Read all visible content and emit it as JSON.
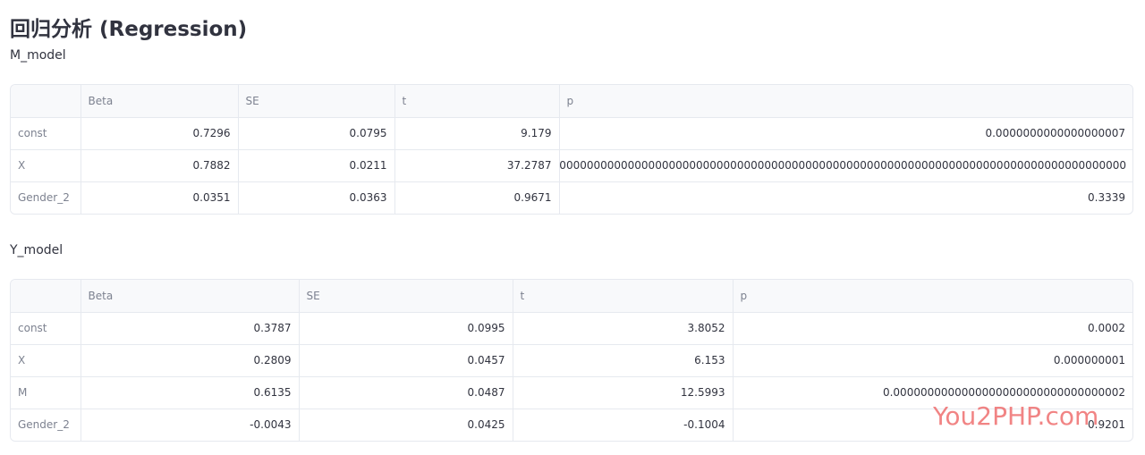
{
  "page": {
    "title": "回归分析 (Regression)"
  },
  "m_model": {
    "label": "M_model",
    "columns": [
      "",
      "Beta",
      "SE",
      "t",
      "p"
    ],
    "rows": [
      {
        "index": "const",
        "beta": "0.7296",
        "se": "0.0795",
        "t": "9.179",
        "p": "0.0000000000000000007"
      },
      {
        "index": "X",
        "beta": "0.7882",
        "se": "0.0211",
        "t": "37.2787",
        "p": "0000000000000000000000000000000000000000000000000000000000000000000000000000000000000000000000000"
      },
      {
        "index": "Gender_2",
        "beta": "0.0351",
        "se": "0.0363",
        "t": "0.9671",
        "p": "0.3339"
      }
    ]
  },
  "y_model": {
    "label": "Y_model",
    "columns": [
      "",
      "Beta",
      "SE",
      "t",
      "p"
    ],
    "rows": [
      {
        "index": "const",
        "beta": "0.3787",
        "se": "0.0995",
        "t": "3.8052",
        "p": "0.0002"
      },
      {
        "index": "X",
        "beta": "0.2809",
        "se": "0.0457",
        "t": "6.153",
        "p": "0.000000001"
      },
      {
        "index": "M",
        "beta": "0.6135",
        "se": "0.0487",
        "t": "12.5993",
        "p": "0.0000000000000000000000000000000002"
      },
      {
        "index": "Gender_2",
        "beta": "-0.0043",
        "se": "0.0425",
        "t": "-0.1004",
        "p": "0.9201"
      }
    ]
  },
  "watermark": {
    "text": "You2PHP.com"
  }
}
